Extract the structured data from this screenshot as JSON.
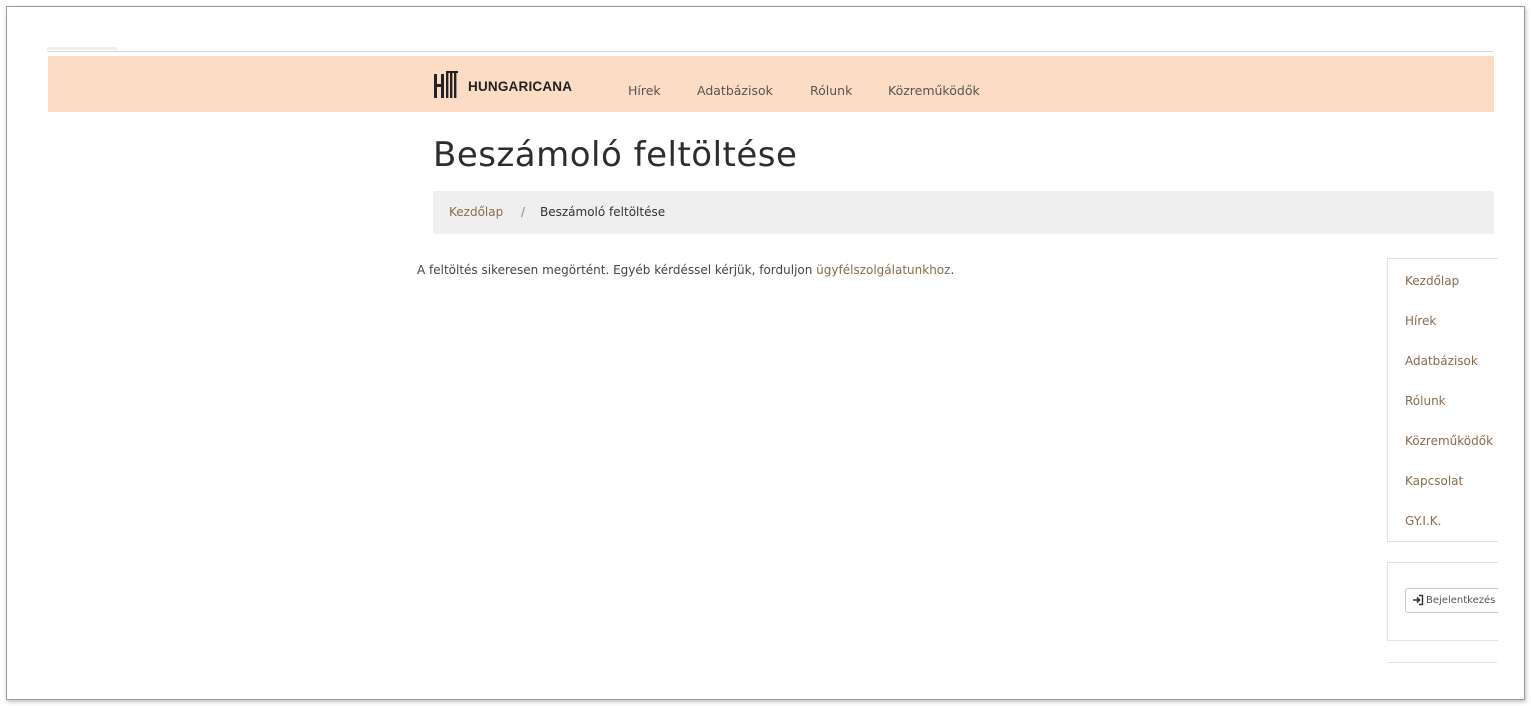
{
  "brand": {
    "name": "HUNGARICANA",
    "logo_icon": "hungaricana-logo-icon"
  },
  "nav": {
    "items": [
      {
        "label": "Hírek"
      },
      {
        "label": "Adatbázisok"
      },
      {
        "label": "Rólunk"
      },
      {
        "label": "Közreműködők"
      }
    ]
  },
  "page": {
    "title": "Beszámoló feltöltése"
  },
  "breadcrumb": {
    "home": "Kezdőlap",
    "separator": "/",
    "current": "Beszámoló feltöltése"
  },
  "message": {
    "text": "A feltöltés sikeresen megörtént. Egyéb kérdéssel kérjük, forduljon ",
    "link": "ügyfélszolgálatunkhoz",
    "end": "."
  },
  "sidebar": {
    "items": [
      {
        "label": "Kezdőlap"
      },
      {
        "label": "Hírek"
      },
      {
        "label": "Adatbázisok"
      },
      {
        "label": "Rólunk"
      },
      {
        "label": "Közreműködők"
      },
      {
        "label": "Kapcsolat"
      },
      {
        "label": "GY.I.K."
      }
    ],
    "login_label": "Bejelentkezés",
    "login_icon": "sign-in-icon"
  },
  "colors": {
    "navbar_bg": "#fcdcc4",
    "link": "#8a6a4a",
    "breadcrumb_bg": "#efefef"
  }
}
